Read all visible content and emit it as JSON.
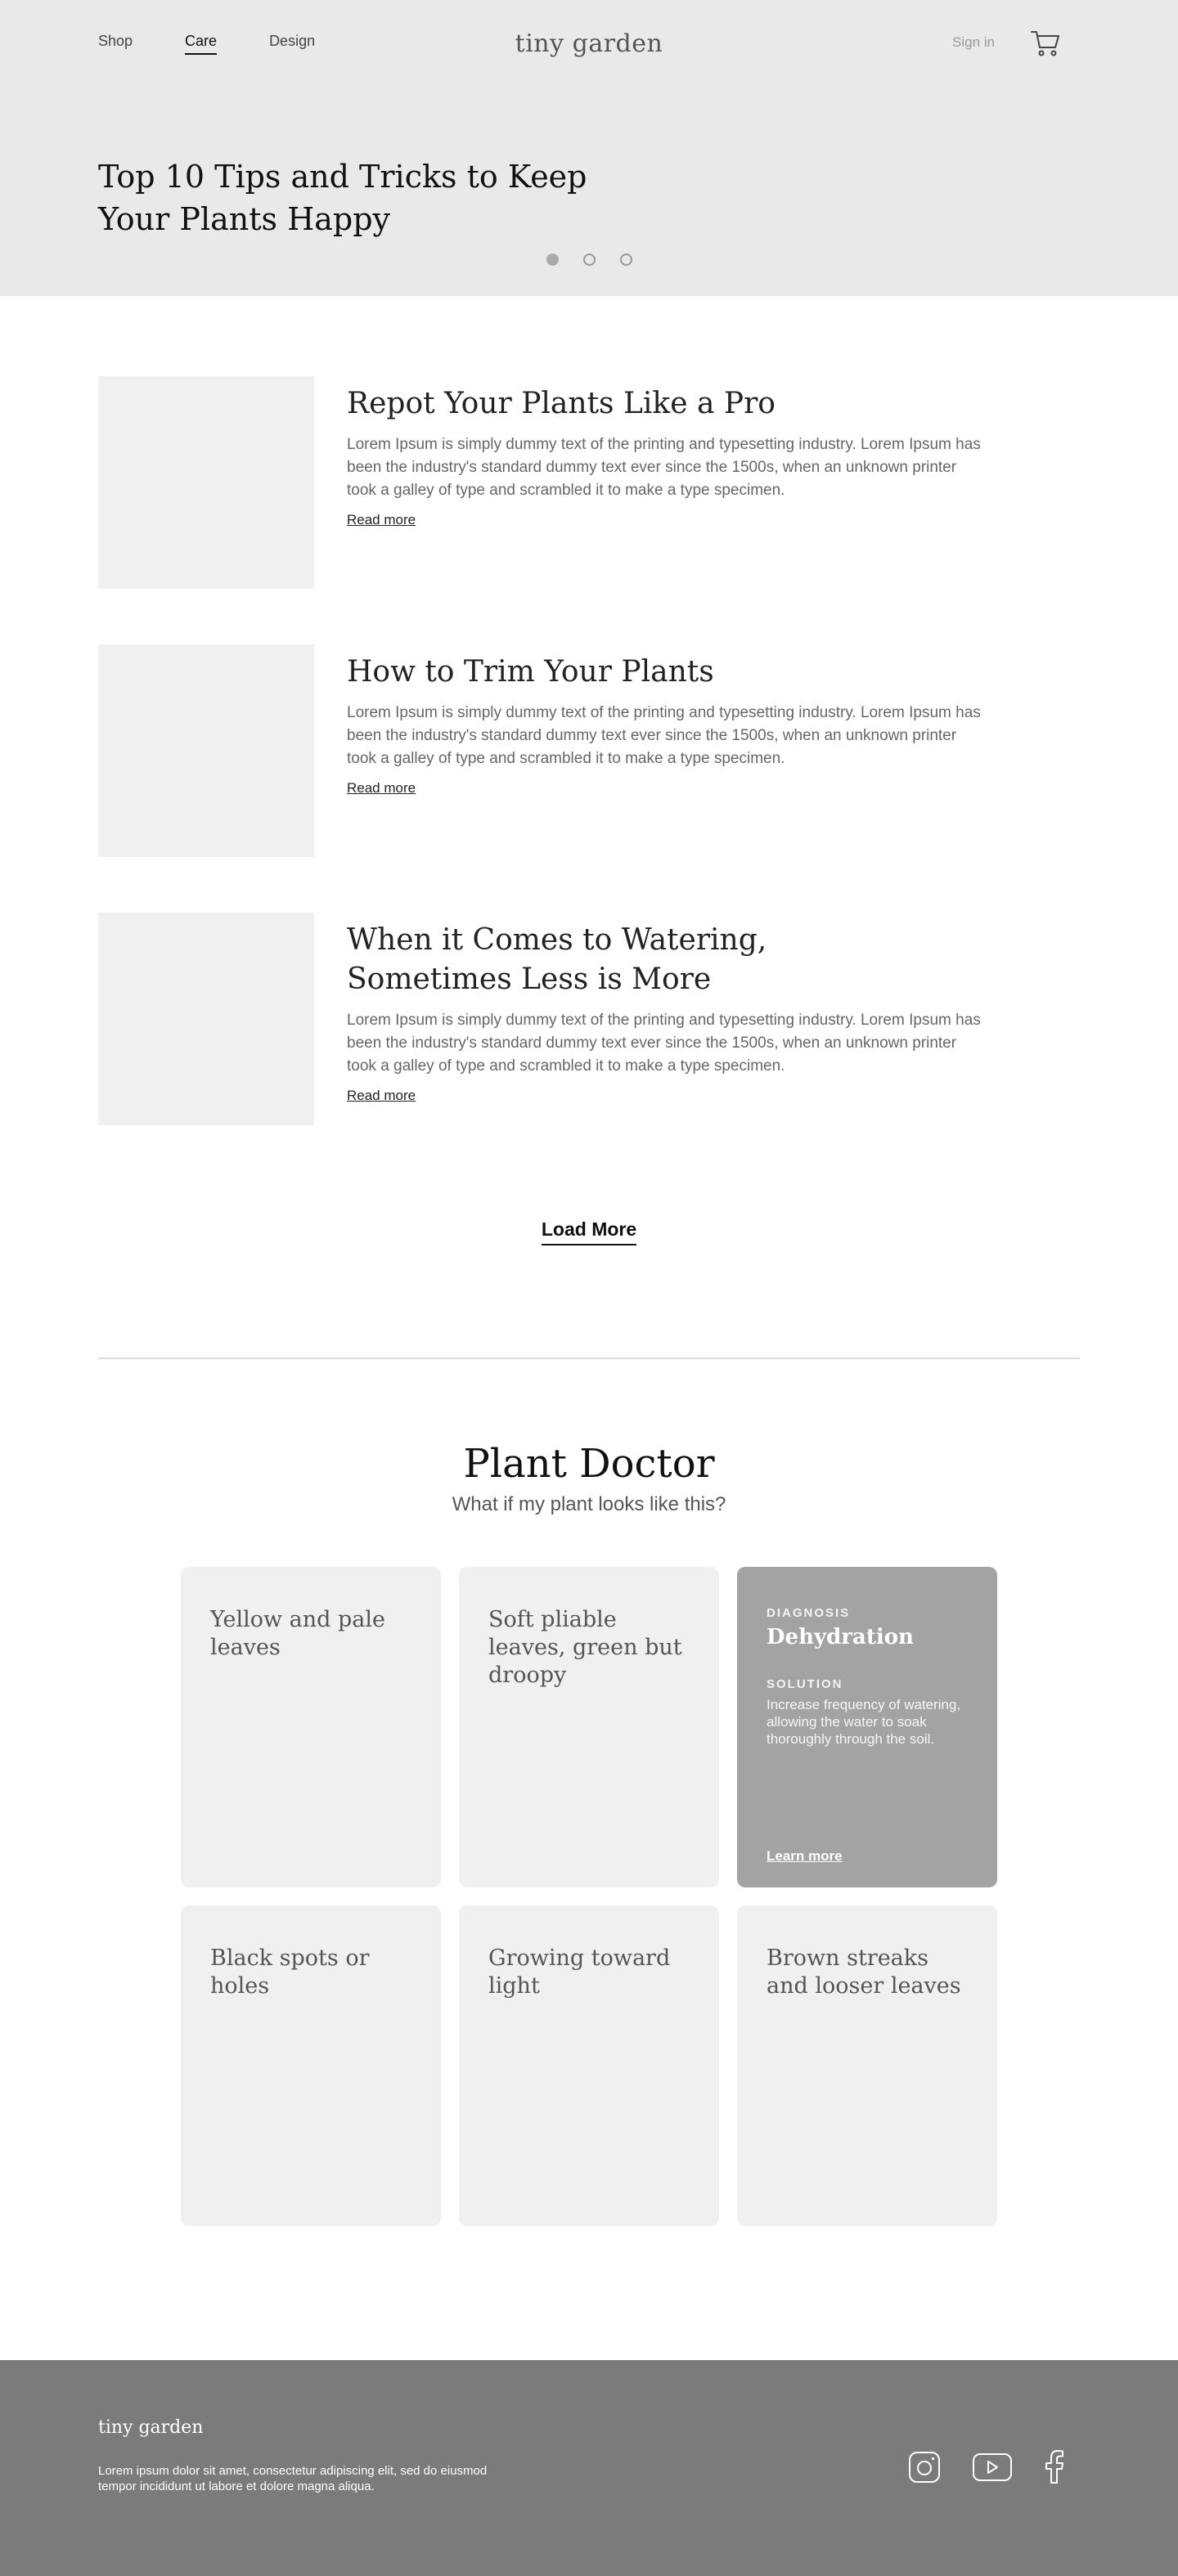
{
  "nav": {
    "items": [
      "Shop",
      "Care",
      "Design"
    ],
    "active": "Care",
    "logo": "tiny garden",
    "sign_in": "Sign in"
  },
  "hero": {
    "title_line1": "Top 10 Tips and Tricks to Keep",
    "title_line2": "Your Plants Happy",
    "carousel_count": 3,
    "carousel_active_index": 0
  },
  "articles": [
    {
      "title": "Repot Your Plants Like a Pro",
      "text": "Lorem Ipsum is simply dummy text of the printing and typesetting industry. Lorem Ipsum has been the industry's standard dummy text ever since the 1500s, when an unknown printer took a galley of type and scrambled it to make a type specimen.",
      "link": "Read more"
    },
    {
      "title": "How to Trim Your Plants",
      "text": "Lorem Ipsum is simply dummy text of the printing and typesetting industry. Lorem Ipsum has been the industry's standard dummy text ever since the 1500s, when an unknown printer took a galley of type and scrambled it to make a type specimen.",
      "link": "Read more"
    },
    {
      "title": "When it Comes to Watering, Sometimes Less is More",
      "text": "Lorem Ipsum is simply dummy text of the printing and typesetting industry. Lorem Ipsum has been the industry's standard dummy text ever since the 1500s, when an unknown printer took a galley of type and scrambled it to make a type specimen.",
      "link": "Read more"
    }
  ],
  "load_more": "Load More",
  "doctor": {
    "title": "Plant Doctor",
    "subtitle": "What if my plant looks like this?",
    "cards": [
      {
        "title": "Yellow and pale leaves"
      },
      {
        "title": "Soft pliable leaves, green but droopy"
      },
      {
        "title": "Black spots or holes"
      },
      {
        "title": "Growing toward light"
      },
      {
        "title": "Brown streaks and looser leaves"
      }
    ],
    "diagnosis_card": {
      "diagnosis_label": "DIAGNOSIS",
      "diagnosis": "Dehydration",
      "solution_label": "SOLUTION",
      "solution": "Increase frequency of watering, allowing the water to soak thoroughly through the soil.",
      "link": "Learn more"
    }
  },
  "footer": {
    "logo": "tiny garden",
    "text": "Lorem ipsum dolor sit amet, consectetur adipiscing elit, sed do eiusmod tempor incididunt ut labore et dolore magna aliqua.",
    "social_icons": [
      "instagram-icon",
      "youtube-icon",
      "facebook-icon"
    ]
  },
  "colors": {
    "hero_bg": "#e9e9e9",
    "placeholder": "#f0f0f0",
    "diagnosis_card": "#a3a3a3",
    "footer_bg": "#7b7b7b"
  }
}
